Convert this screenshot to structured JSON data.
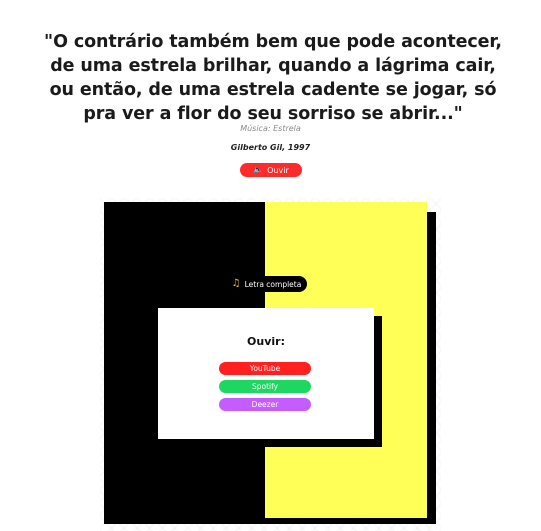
{
  "quote": {
    "text": "\"O contrário também bem que pode acontecer, de uma estrela brilhar, quando a lágrima cair, ou então, de uma estrela cadente se jogar, só pra ver a flor do seu sorriso se abrir...\"",
    "music": "Música: Estrela",
    "author": "Gilberto Gil, 1997"
  },
  "listen_button": {
    "label": "Ouvir",
    "icon": "speaker-icon"
  },
  "lyrics_button": {
    "label": "Letra completa",
    "icon": "music-note-icon"
  },
  "modal": {
    "title": "Ouvir:",
    "services": [
      {
        "label": "YouTube",
        "color": "#ff2020"
      },
      {
        "label": "Spotify",
        "color": "#1ed760"
      },
      {
        "label": "Deezer",
        "color": "#c45cff"
      }
    ]
  },
  "colors": {
    "accent_red": "#ff2b2b",
    "panel_black": "#000000",
    "panel_yellow": "#ffff57"
  }
}
